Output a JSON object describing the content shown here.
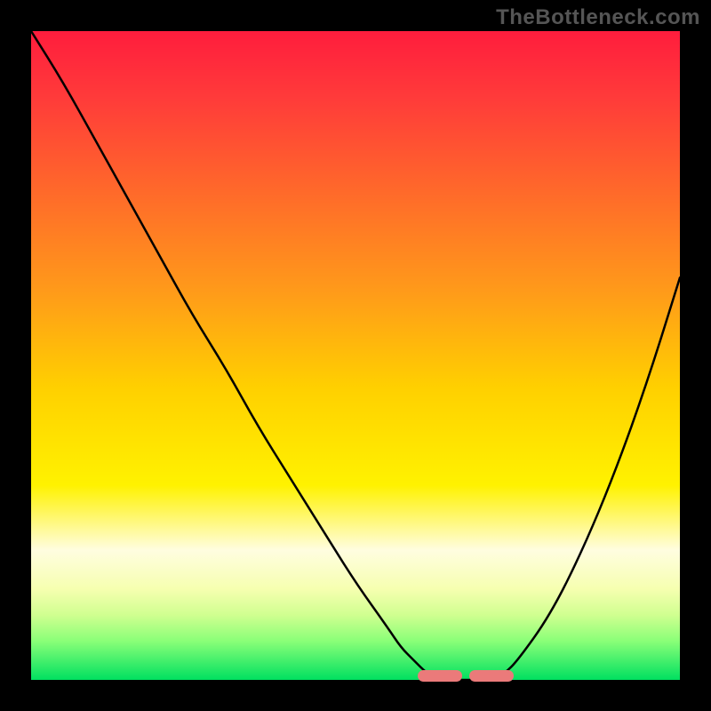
{
  "watermark": "TheBottleneck.com",
  "colors": {
    "page_bg": "#000000",
    "gradient_top": "#ff1d3d",
    "gradient_bottom": "#00e060",
    "curve": "#000000",
    "flat_marker": "#eb7a7a",
    "watermark_text": "#555555"
  },
  "chart_data": {
    "type": "line",
    "title": "",
    "xlabel": "",
    "ylabel": "",
    "xlim": [
      0,
      100
    ],
    "ylim": [
      0,
      100
    ],
    "grid": false,
    "note": "No numeric axes or tick labels are visible; values are estimated from the curve geometry relative to the plot area as percentages.",
    "x": [
      0,
      5,
      10,
      15,
      20,
      25,
      30,
      35,
      40,
      45,
      50,
      55,
      57,
      59,
      61,
      63,
      65,
      67,
      69,
      71,
      73,
      75,
      80,
      85,
      90,
      95,
      100
    ],
    "y": [
      100,
      92,
      83,
      74,
      65,
      56,
      48,
      39,
      31,
      23,
      15,
      8,
      5,
      3,
      1,
      0,
      0,
      0,
      0,
      0,
      1,
      3,
      10,
      20,
      32,
      46,
      62
    ],
    "flat_region_x": [
      63,
      72
    ],
    "flat_region_y": 0
  }
}
